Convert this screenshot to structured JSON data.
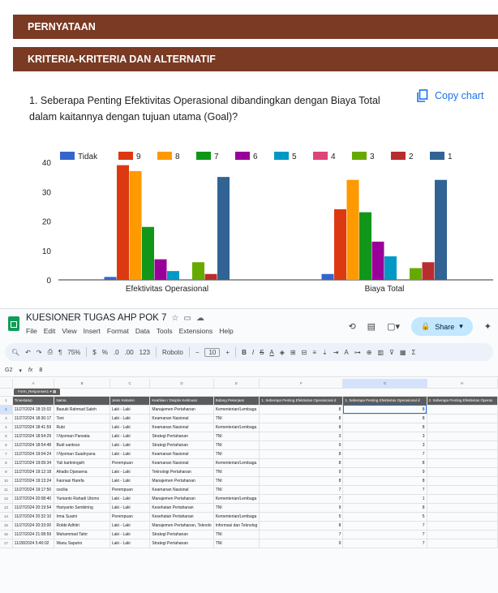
{
  "form": {
    "section1": "PERNYATAAN",
    "section2": "KRITERIA-KRITERIA DAN ALTERNATIF",
    "question": "1. Seberapa Penting Efektivitas Operasional dibandingkan dengan Biaya Total dalam kaitannya dengan tujuan utama (Goal)?",
    "copy_chart": "Copy chart"
  },
  "chart_data": {
    "type": "bar",
    "categories": [
      "Efektivitas Operasional",
      "Biaya Total"
    ],
    "series": [
      {
        "name": "Tidak",
        "color": "#3366cc",
        "values": [
          1,
          2
        ]
      },
      {
        "name": "9",
        "color": "#dc3912",
        "values": [
          39,
          24
        ]
      },
      {
        "name": "8",
        "color": "#ff9900",
        "values": [
          37,
          34
        ]
      },
      {
        "name": "7",
        "color": "#109618",
        "values": [
          18,
          23
        ]
      },
      {
        "name": "6",
        "color": "#990099",
        "values": [
          7,
          13
        ]
      },
      {
        "name": "5",
        "color": "#0099c6",
        "values": [
          3,
          8
        ]
      },
      {
        "name": "4",
        "color": "#dd4477",
        "values": [
          0,
          0
        ]
      },
      {
        "name": "3",
        "color": "#66aa00",
        "values": [
          6,
          4
        ]
      },
      {
        "name": "2",
        "color": "#b82e2e",
        "values": [
          2,
          6
        ]
      },
      {
        "name": "1",
        "color": "#316395",
        "values": [
          35,
          34
        ]
      }
    ],
    "yticks": [
      "0",
      "10",
      "20",
      "30",
      "40"
    ],
    "ylim": [
      0,
      40
    ],
    "legend": "top",
    "grid": false
  },
  "sheets": {
    "title": "KUESIONER TUGAS AHP POK 7",
    "menu": [
      "File",
      "Edit",
      "View",
      "Insert",
      "Format",
      "Data",
      "Tools",
      "Extensions",
      "Help"
    ],
    "share": "Share",
    "zoom": "75%",
    "font": "Roboto",
    "font_size": "10",
    "num_format": "123",
    "cell_ref": "G2",
    "formula": "8",
    "col_letters": [
      "A",
      "B",
      "C",
      "D",
      "E",
      "F",
      "G",
      "H"
    ],
    "sheet_tab": "Form_Responses1",
    "headers": [
      "Timestamp",
      "Nama",
      "Jenis Kelamin",
      "Keahlian / Disiplin Keilmuan",
      "Bidang Pekerjaan",
      "1. Seberapa Penting Efektivitas Operasional d",
      "1. Seberapa Penting Efektivitas Operasional d",
      "2. Seberapa Penting Efektivitas Operas"
    ],
    "rows": [
      [
        "2",
        "11/27/2024 18:15:02",
        "Basuki Rahmad Saleh",
        "Laki - Laki",
        "Manajemen Pertahanan",
        "Kementerian/Lembaga",
        "8",
        "8"
      ],
      [
        "3",
        "11/27/2024 18:30:17",
        "Toni",
        "Laki - Laki",
        "Keamanan Nasional",
        "TNI",
        "8",
        "8"
      ],
      [
        "4",
        "11/27/2024 18:41:59",
        "Rubi",
        "Laki - Laki",
        "Keamanan Nasional",
        "Kementerian/Lembaga",
        "8",
        "8"
      ],
      [
        "5",
        "11/27/2024 18:54:29",
        "I Nyoman Parwata",
        "Laki - Laki",
        "Strategi Pertahanan",
        "TNI",
        "3",
        "3"
      ],
      [
        "6",
        "11/27/2024 18:54:48",
        "Budi santoso",
        "Laki - Laki",
        "Strategi Pertahanan",
        "TNI",
        "9",
        "3"
      ],
      [
        "7",
        "11/27/2024 19:04:24",
        "I Nyoman Suadnyana",
        "Laki - Laki",
        "Keamanan Nasional",
        "TNI",
        "8",
        "7"
      ],
      [
        "8",
        "11/27/2024 19:09:34",
        "Yuli kartiningsih",
        "Perempuan",
        "Keamanan Nasional",
        "Kementerian/Lembaga",
        "8",
        "8"
      ],
      [
        "9",
        "11/27/2024 19:12:18",
        "Ahadis Djanaena",
        "Laki - Laki",
        "Teknologi Pertahanan",
        "TNI",
        "9",
        "9"
      ],
      [
        "10",
        "11/27/2024 19:13:24",
        "Faonasi Harefa",
        "Laki - Laki",
        "Manajemen Pertahanan",
        "TNI",
        "8",
        "8"
      ],
      [
        "11",
        "11/27/2024 19:17:50",
        "cecilia",
        "Perempuan",
        "Keamanan Nasional",
        "TNI",
        "7",
        "7"
      ],
      [
        "12",
        "11/27/2024 20:08:40",
        "Yunianto Rahadi Utomo",
        "Laki - Laki",
        "Manajemen Pertahanan",
        "Kementerian/Lembaga",
        "7",
        "1"
      ],
      [
        "13",
        "11/27/2024 20:19:54",
        "Hariyanto Sembiring",
        "Laki - Laki",
        "Kesehatan Pertahanan",
        "TNI",
        "9",
        "8"
      ],
      [
        "14",
        "11/27/2024 20:32:10",
        "Irma Suami",
        "Perempuan",
        "Kesehatan Pertahanan",
        "Kementerian/Lembaga",
        "5",
        "5"
      ],
      [
        "15",
        "11/27/2024 20:33:00",
        "Robbi Adhitri",
        "Laki - Laki",
        "Manajemen Pertahanan, Teknolo",
        "Informasi dan Teknolog",
        "8",
        "7"
      ],
      [
        "16",
        "11/27/2024 21:08:59",
        "Muhammad Tahir",
        "Laki - Laki",
        "Strategi Pertahanan",
        "TNI",
        "7",
        "7"
      ],
      [
        "17",
        "11/28/2024 5:40:02",
        "Wanu Saputro",
        "Laki - Laki",
        "Strategi Pertahanan",
        "TNI",
        "9",
        "7"
      ]
    ]
  }
}
